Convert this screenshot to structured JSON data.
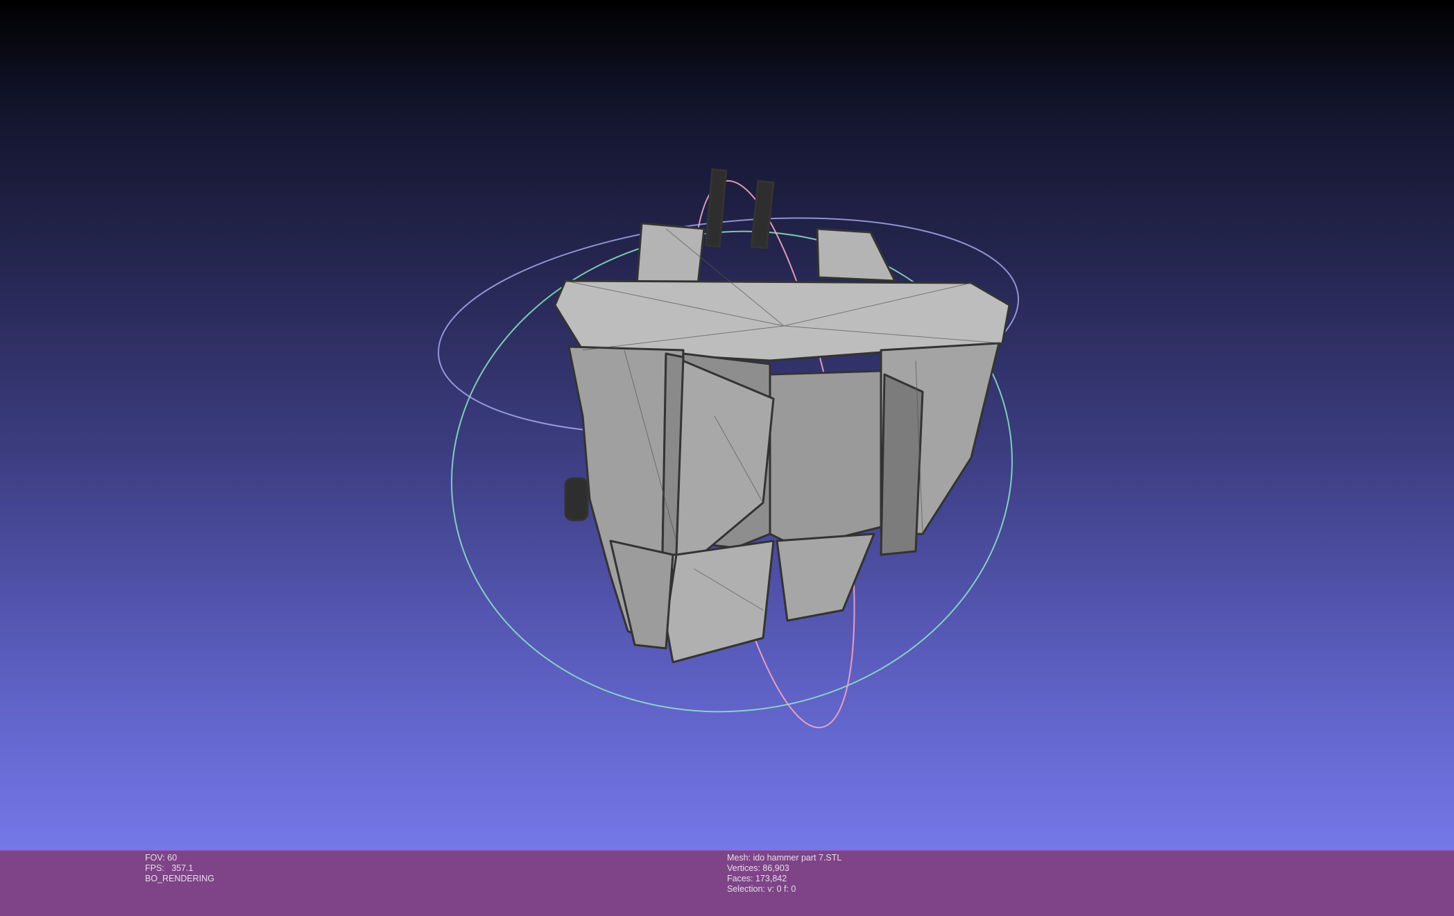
{
  "viewer": {
    "background_top": "#000000",
    "background_bottom": "#7478e8",
    "mesh_color": "#a9a9a9",
    "edge_color": "#3a3a3a"
  },
  "trackball": {
    "ring_colors": [
      "#8ee6c8",
      "#f5a6c4",
      "#b8b8ff"
    ]
  },
  "status_bar": {
    "color": "#7e4487",
    "left": {
      "fov_label": "FOV: 60",
      "fps_label": "FPS:   357.1",
      "render_mode": "BO_RENDERING"
    },
    "right": {
      "mesh_label": "Mesh: ido hammer part 7.STL",
      "vertices_label": "Vertices: 86,903",
      "faces_label": "Faces: 173,842",
      "selection_label": "Selection: v: 0 f: 0"
    }
  }
}
